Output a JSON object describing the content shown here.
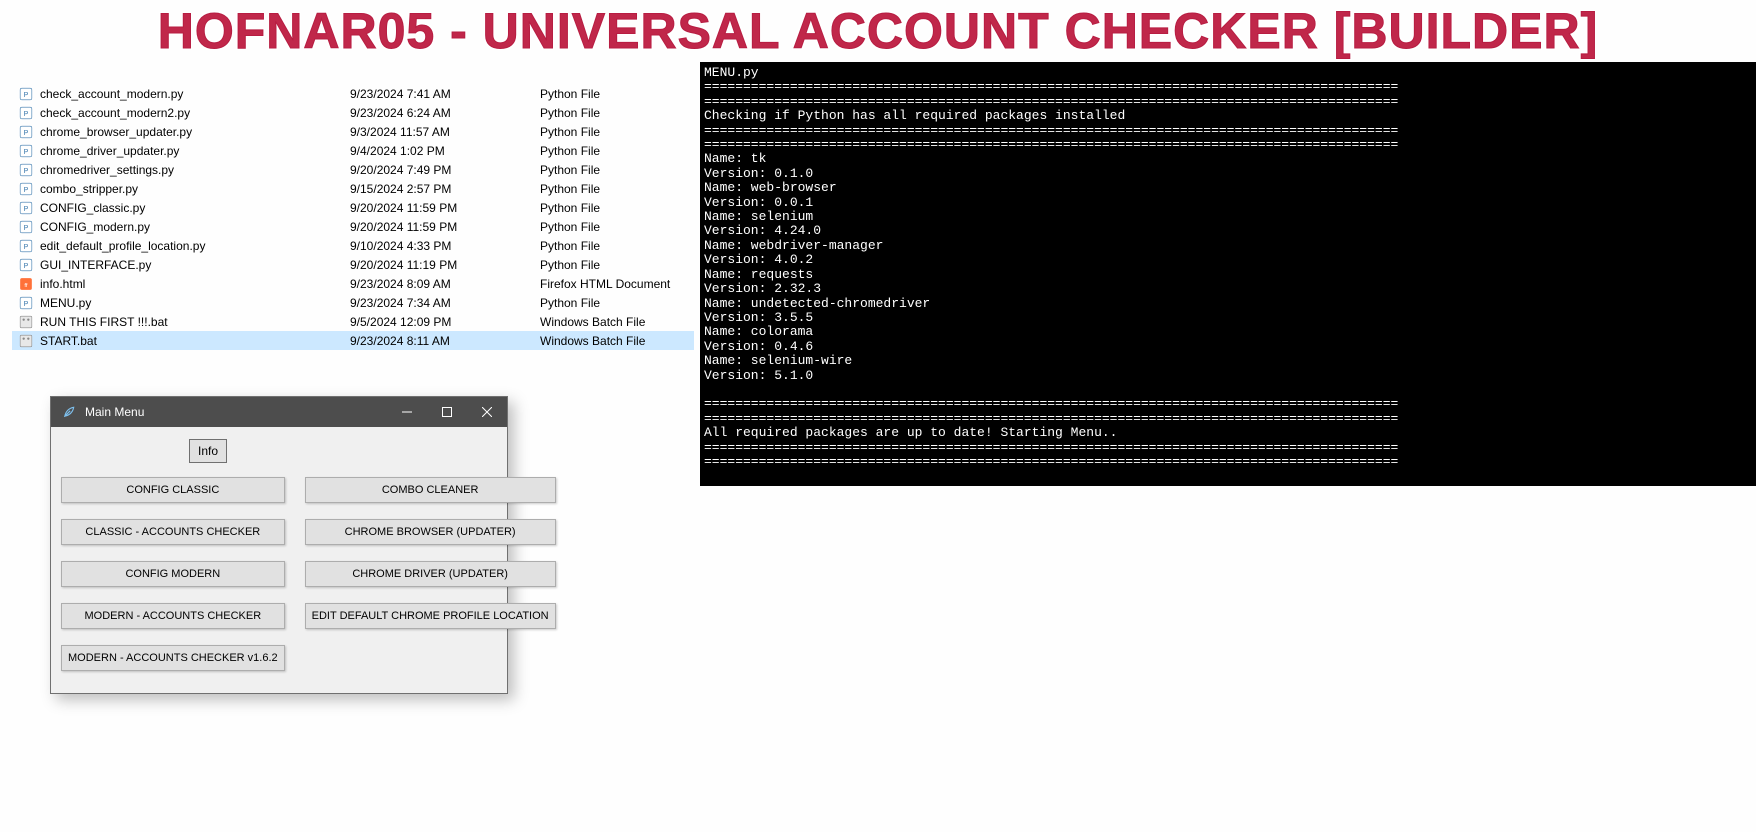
{
  "banner_title": "HOFNAR05 - UNIVERSAL ACCOUNT CHECKER [BUILDER]",
  "explorer": {
    "files": [
      {
        "icon": "py",
        "name": "check_account_modern.py",
        "date": "9/23/2024 7:41 AM",
        "type": "Python File"
      },
      {
        "icon": "py",
        "name": "check_account_modern2.py",
        "date": "9/23/2024 6:24 AM",
        "type": "Python File"
      },
      {
        "icon": "py",
        "name": "chrome_browser_updater.py",
        "date": "9/3/2024 11:57 AM",
        "type": "Python File"
      },
      {
        "icon": "py",
        "name": "chrome_driver_updater.py",
        "date": "9/4/2024 1:02 PM",
        "type": "Python File"
      },
      {
        "icon": "py",
        "name": "chromedriver_settings.py",
        "date": "9/20/2024 7:49 PM",
        "type": "Python File"
      },
      {
        "icon": "py",
        "name": "combo_stripper.py",
        "date": "9/15/2024 2:57 PM",
        "type": "Python File"
      },
      {
        "icon": "py",
        "name": "CONFIG_classic.py",
        "date": "9/20/2024 11:59 PM",
        "type": "Python File"
      },
      {
        "icon": "py",
        "name": "CONFIG_modern.py",
        "date": "9/20/2024 11:59 PM",
        "type": "Python File"
      },
      {
        "icon": "py",
        "name": "edit_default_profile_location.py",
        "date": "9/10/2024 4:33 PM",
        "type": "Python File"
      },
      {
        "icon": "py",
        "name": "GUI_INTERFACE.py",
        "date": "9/20/2024 11:19 PM",
        "type": "Python File"
      },
      {
        "icon": "html",
        "name": "info.html",
        "date": "9/23/2024 8:09 AM",
        "type": "Firefox HTML Document"
      },
      {
        "icon": "py",
        "name": "MENU.py",
        "date": "9/23/2024 7:34 AM",
        "type": "Python File"
      },
      {
        "icon": "bat",
        "name": "RUN THIS FIRST !!!.bat",
        "date": "9/5/2024 12:09 PM",
        "type": "Windows Batch File"
      },
      {
        "icon": "bat",
        "name": "START.bat",
        "date": "9/23/2024 8:11 AM",
        "type": "Windows Batch File",
        "selected": true
      }
    ]
  },
  "terminal_lines": [
    "MENU.py",
    "=========================================================================================",
    "=========================================================================================",
    "Checking if Python has all required packages installed",
    "=========================================================================================",
    "=========================================================================================",
    "Name: tk",
    "Version: 0.1.0",
    "Name: web-browser",
    "Version: 0.0.1",
    "Name: selenium",
    "Version: 4.24.0",
    "Name: webdriver-manager",
    "Version: 4.0.2",
    "Name: requests",
    "Version: 2.32.3",
    "Name: undetected-chromedriver",
    "Version: 3.5.5",
    "Name: colorama",
    "Version: 0.4.6",
    "Name: selenium-wire",
    "Version: 5.1.0",
    "",
    "=========================================================================================",
    "=========================================================================================",
    "All required packages are up to date! Starting Menu..",
    "=========================================================================================",
    "========================================================================================="
  ],
  "menu_window": {
    "title": "Main Menu",
    "info_label": "Info",
    "left_buttons": [
      "CONFIG CLASSIC",
      "CLASSIC - ACCOUNTS CHECKER",
      "CONFIG MODERN",
      "MODERN - ACCOUNTS CHECKER",
      "MODERN - ACCOUNTS CHECKER v1.6.2"
    ],
    "right_buttons": [
      "COMBO CLEANER",
      "CHROME BROWSER (UPDATER)",
      "CHROME DRIVER (UPDATER)",
      "EDIT DEFAULT CHROME PROFILE LOCATION"
    ]
  }
}
